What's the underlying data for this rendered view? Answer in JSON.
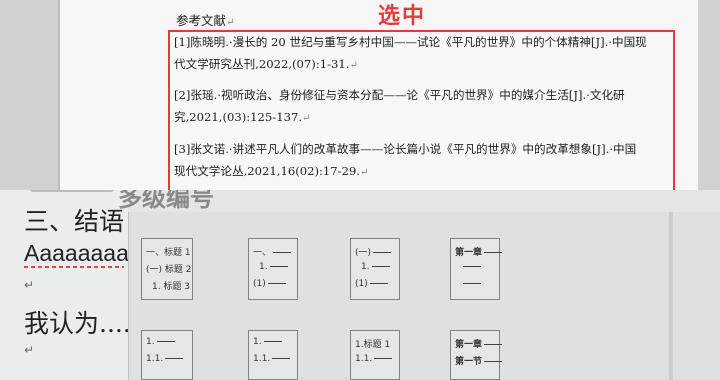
{
  "document": {
    "ref_heading": "参考文献",
    "selection_label": "选中",
    "references": [
      {
        "line1": "[1]陈晓明.·漫长的 20 世纪与重写乡村中国——试论《平凡的世界》中的个体精神[J].·中国现",
        "line2": "代文学研究丛刊,2022,(07):1-31."
      },
      {
        "line1": "[2]张瑶.·视听政治、身份修征与资本分配——论《平凡的世界》中的媒介生活[J].·文化研",
        "line2": "究,2021,(03):125-137."
      },
      {
        "line1": "[3]张文诺.·讲述平凡人们的改革故事——论长篇小说《平凡的世界》中的改革想象[J].·中国",
        "line2": "现代文学论丛,2021,16(02):17-29."
      }
    ]
  },
  "editor": {
    "heading_partial": "多级编号",
    "conclusion": "三、结语",
    "typed_text": "Aaaaaaaa",
    "thought_text": "我认为....",
    "return_mark": "↵"
  },
  "numbering_gallery": {
    "styles": [
      {
        "lines": [
          "一、标题 1",
          "(一) 标题 2",
          "1. 标题 3"
        ]
      },
      {
        "lines": [
          "一、",
          "1.",
          "(1)"
        ]
      },
      {
        "lines": [
          "(一)",
          "1.",
          "(1)"
        ]
      },
      {
        "lines": [
          "第一章",
          "",
          ""
        ]
      },
      {
        "lines": [
          "1.",
          "1.1.",
          ""
        ]
      },
      {
        "lines": [
          "1.",
          "1.1.",
          ""
        ]
      },
      {
        "lines": [
          "1.标题 1",
          "1.1.",
          ""
        ]
      },
      {
        "lines": [
          "第一章",
          "第一节",
          ""
        ]
      }
    ]
  }
}
